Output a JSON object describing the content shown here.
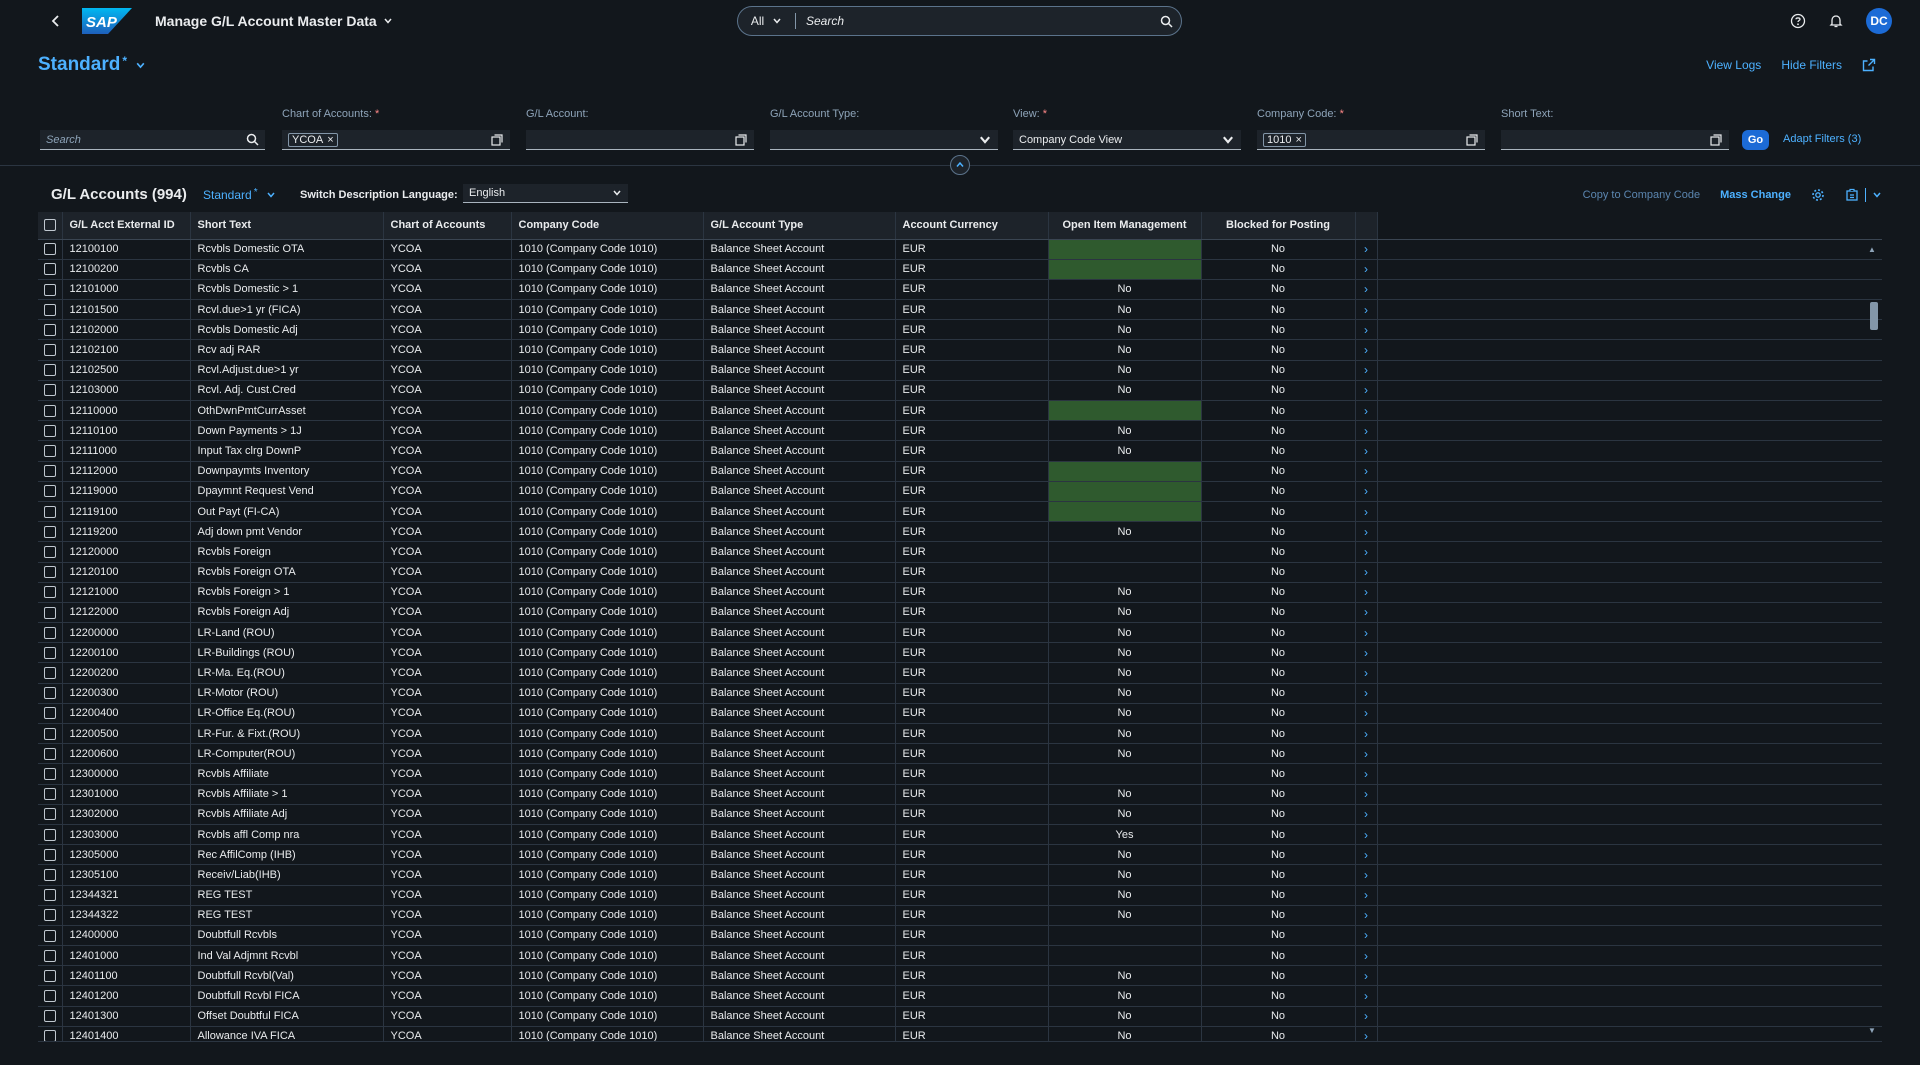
{
  "shell": {
    "app_title": "Manage G/L Account Master Data",
    "search_scope": "All",
    "search_placeholder": "Search",
    "avatar_initials": "DC"
  },
  "header": {
    "variant": "Standard",
    "variant_modified": "*",
    "view_logs": "View Logs",
    "hide_filters": "Hide Filters"
  },
  "filters": {
    "search_placeholder": "Search",
    "chart_of_accounts": {
      "label": "Chart of Accounts:",
      "token": "YCOA"
    },
    "gl_account": {
      "label": "G/L Account:"
    },
    "gl_account_type": {
      "label": "G/L Account Type:"
    },
    "view": {
      "label": "View:",
      "value": "Company Code View"
    },
    "company_code": {
      "label": "Company Code:",
      "token": "1010"
    },
    "short_text": {
      "label": "Short Text:"
    },
    "go": "Go",
    "adapt": "Adapt Filters (3)"
  },
  "table": {
    "title": "G/L Accounts (994)",
    "variant": "Standard",
    "variant_modified": "*",
    "lang_label": "Switch Description Language:",
    "lang_value": "English",
    "copy_to_cc": "Copy to Company Code",
    "mass_change": "Mass Change",
    "columns": [
      "G/L Acct External ID",
      "Short Text",
      "Chart of Accounts",
      "Company Code",
      "G/L Account Type",
      "Account Currency",
      "Open Item Management",
      "Blocked for Posting"
    ],
    "rows": [
      [
        "12100100",
        "Rcvbls Domestic OTA",
        "YCOA",
        "1010 (Company Code 1010)",
        "Balance Sheet Account",
        "EUR",
        "",
        "No"
      ],
      [
        "12100200",
        "Rcvbls CA",
        "YCOA",
        "1010 (Company Code 1010)",
        "Balance Sheet Account",
        "EUR",
        "",
        "No"
      ],
      [
        "12101000",
        "Rcvbls Domestic > 1",
        "YCOA",
        "1010 (Company Code 1010)",
        "Balance Sheet Account",
        "EUR",
        "No",
        "No"
      ],
      [
        "12101500",
        "Rcvl.due>1 yr (FICA)",
        "YCOA",
        "1010 (Company Code 1010)",
        "Balance Sheet Account",
        "EUR",
        "No",
        "No"
      ],
      [
        "12102000",
        "Rcvbls Domestic Adj",
        "YCOA",
        "1010 (Company Code 1010)",
        "Balance Sheet Account",
        "EUR",
        "No",
        "No"
      ],
      [
        "12102100",
        "Rcv adj RAR",
        "YCOA",
        "1010 (Company Code 1010)",
        "Balance Sheet Account",
        "EUR",
        "No",
        "No"
      ],
      [
        "12102500",
        "Rcvl.Adjust.due>1 yr",
        "YCOA",
        "1010 (Company Code 1010)",
        "Balance Sheet Account",
        "EUR",
        "No",
        "No"
      ],
      [
        "12103000",
        "Rcvl. Adj. Cust.Cred",
        "YCOA",
        "1010 (Company Code 1010)",
        "Balance Sheet Account",
        "EUR",
        "No",
        "No"
      ],
      [
        "12110000",
        "OthDwnPmtCurrAsset",
        "YCOA",
        "1010 (Company Code 1010)",
        "Balance Sheet Account",
        "EUR",
        "",
        "No"
      ],
      [
        "12110100",
        "Down Payments > 1J",
        "YCOA",
        "1010 (Company Code 1010)",
        "Balance Sheet Account",
        "EUR",
        "No",
        "No"
      ],
      [
        "12111000",
        "Input Tax clrg DownP",
        "YCOA",
        "1010 (Company Code 1010)",
        "Balance Sheet Account",
        "EUR",
        "No",
        "No"
      ],
      [
        "12112000",
        "Downpaymts Inventory",
        "YCOA",
        "1010 (Company Code 1010)",
        "Balance Sheet Account",
        "EUR",
        "",
        "No"
      ],
      [
        "12119000",
        "Dpaymnt Request Vend",
        "YCOA",
        "1010 (Company Code 1010)",
        "Balance Sheet Account",
        "EUR",
        "",
        "No"
      ],
      [
        "12119100",
        "Out Payt (FI-CA)",
        "YCOA",
        "1010 (Company Code 1010)",
        "Balance Sheet Account",
        "EUR",
        "",
        "No"
      ],
      [
        "12119200",
        "Adj down pmt Vendor",
        "YCOA",
        "1010 (Company Code 1010)",
        "Balance Sheet Account",
        "EUR",
        "No",
        "No"
      ],
      [
        "12120000",
        "Rcvbls Foreign",
        "YCOA",
        "1010 (Company Code 1010)",
        "Balance Sheet Account",
        "EUR",
        "",
        "No"
      ],
      [
        "12120100",
        "Rcvbls Foreign OTA",
        "YCOA",
        "1010 (Company Code 1010)",
        "Balance Sheet Account",
        "EUR",
        "",
        "No"
      ],
      [
        "12121000",
        "Rcvbls Foreign > 1",
        "YCOA",
        "1010 (Company Code 1010)",
        "Balance Sheet Account",
        "EUR",
        "No",
        "No"
      ],
      [
        "12122000",
        "Rcvbls Foreign Adj",
        "YCOA",
        "1010 (Company Code 1010)",
        "Balance Sheet Account",
        "EUR",
        "No",
        "No"
      ],
      [
        "12200000",
        "LR-Land (ROU)",
        "YCOA",
        "1010 (Company Code 1010)",
        "Balance Sheet Account",
        "EUR",
        "No",
        "No"
      ],
      [
        "12200100",
        "LR-Buildings (ROU)",
        "YCOA",
        "1010 (Company Code 1010)",
        "Balance Sheet Account",
        "EUR",
        "No",
        "No"
      ],
      [
        "12200200",
        "LR-Ma. Eq.(ROU)",
        "YCOA",
        "1010 (Company Code 1010)",
        "Balance Sheet Account",
        "EUR",
        "No",
        "No"
      ],
      [
        "12200300",
        "LR-Motor (ROU)",
        "YCOA",
        "1010 (Company Code 1010)",
        "Balance Sheet Account",
        "EUR",
        "No",
        "No"
      ],
      [
        "12200400",
        "LR-Office Eq.(ROU)",
        "YCOA",
        "1010 (Company Code 1010)",
        "Balance Sheet Account",
        "EUR",
        "No",
        "No"
      ],
      [
        "12200500",
        "LR-Fur. & Fixt.(ROU)",
        "YCOA",
        "1010 (Company Code 1010)",
        "Balance Sheet Account",
        "EUR",
        "No",
        "No"
      ],
      [
        "12200600",
        "LR-Computer(ROU)",
        "YCOA",
        "1010 (Company Code 1010)",
        "Balance Sheet Account",
        "EUR",
        "No",
        "No"
      ],
      [
        "12300000",
        "Rcvbls Affiliate",
        "YCOA",
        "1010 (Company Code 1010)",
        "Balance Sheet Account",
        "EUR",
        "",
        "No"
      ],
      [
        "12301000",
        "Rcvbls Affiliate > 1",
        "YCOA",
        "1010 (Company Code 1010)",
        "Balance Sheet Account",
        "EUR",
        "No",
        "No"
      ],
      [
        "12302000",
        "Rcvbls Affiliate Adj",
        "YCOA",
        "1010 (Company Code 1010)",
        "Balance Sheet Account",
        "EUR",
        "No",
        "No"
      ],
      [
        "12303000",
        "Rcvbls affl Comp nra",
        "YCOA",
        "1010 (Company Code 1010)",
        "Balance Sheet Account",
        "EUR",
        "Yes",
        "No"
      ],
      [
        "12305000",
        "Rec AffilComp (IHB)",
        "YCOA",
        "1010 (Company Code 1010)",
        "Balance Sheet Account",
        "EUR",
        "No",
        "No"
      ],
      [
        "12305100",
        "Receiv/Liab(IHB)",
        "YCOA",
        "1010 (Company Code 1010)",
        "Balance Sheet Account",
        "EUR",
        "No",
        "No"
      ],
      [
        "12344321",
        "REG TEST",
        "YCOA",
        "1010 (Company Code 1010)",
        "Balance Sheet Account",
        "EUR",
        "No",
        "No"
      ],
      [
        "12344322",
        "REG TEST",
        "YCOA",
        "1010 (Company Code 1010)",
        "Balance Sheet Account",
        "EUR",
        "No",
        "No"
      ],
      [
        "12400000",
        "Doubtfull Rcvbls",
        "YCOA",
        "1010 (Company Code 1010)",
        "Balance Sheet Account",
        "EUR",
        "",
        "No"
      ],
      [
        "12401000",
        "Ind Val Adjmnt Rcvbl",
        "YCOA",
        "1010 (Company Code 1010)",
        "Balance Sheet Account",
        "EUR",
        "",
        "No"
      ],
      [
        "12401100",
        "Doubtfull Rcvbl(Val)",
        "YCOA",
        "1010 (Company Code 1010)",
        "Balance Sheet Account",
        "EUR",
        "No",
        "No"
      ],
      [
        "12401200",
        "Doubtfull Rcvbl FICA",
        "YCOA",
        "1010 (Company Code 1010)",
        "Balance Sheet Account",
        "EUR",
        "No",
        "No"
      ],
      [
        "12401300",
        "Offset Doubtful FICA",
        "YCOA",
        "1010 (Company Code 1010)",
        "Balance Sheet Account",
        "EUR",
        "No",
        "No"
      ],
      [
        "12401400",
        "Allowance IVA FICA",
        "YCOA",
        "1010 (Company Code 1010)",
        "Balance Sheet Account",
        "EUR",
        "No",
        "No"
      ]
    ],
    "highlighted_rows": [
      0,
      1,
      8,
      11,
      12,
      13
    ]
  },
  "colors": {
    "background": "#12171c",
    "link": "#4db1ff",
    "emphasized_button": "#1c6bd6",
    "highlight": "#2f5a2e"
  }
}
